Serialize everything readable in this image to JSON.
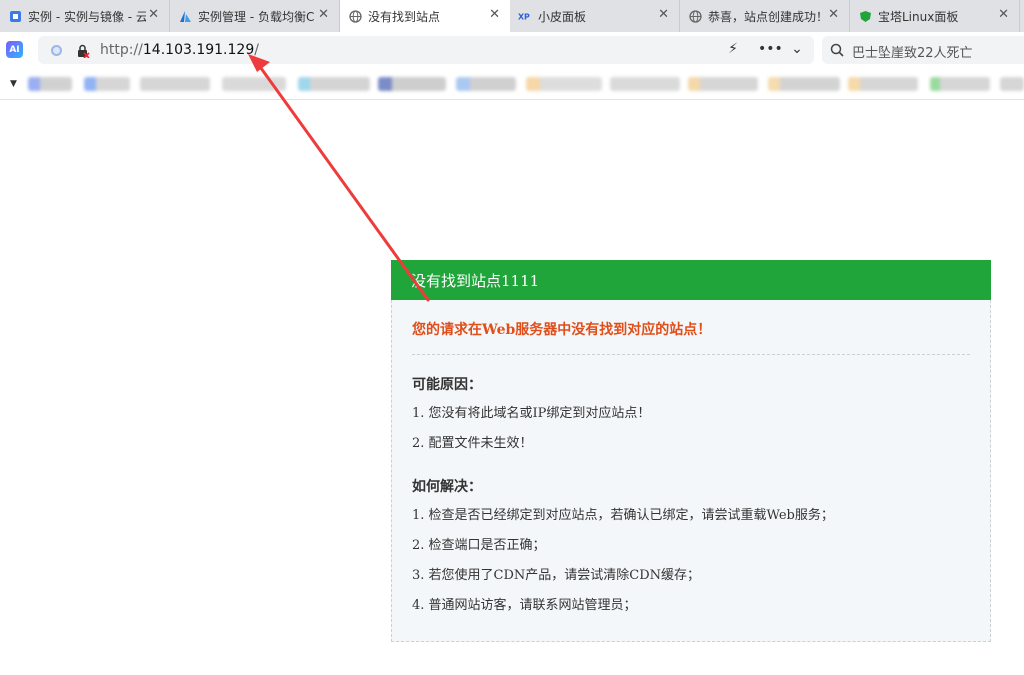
{
  "tabs": [
    {
      "label": "实例 - 实例与镜像 - 云",
      "icon": "cube-icon",
      "active": false
    },
    {
      "label": "实例管理 - 负载均衡C",
      "icon": "azure-icon",
      "active": false
    },
    {
      "label": "没有找到站点",
      "icon": "globe-icon",
      "active": true
    },
    {
      "label": "小皮面板",
      "icon": "xp-logo-icon",
      "active": false
    },
    {
      "label": "恭喜，站点创建成功！",
      "icon": "globe-icon",
      "active": false
    },
    {
      "label": "宝塔Linux面板",
      "icon": "shield-icon",
      "active": false
    }
  ],
  "address": {
    "scheme": "http://",
    "host": "14.103.191.129",
    "path": "/"
  },
  "search": {
    "text": "巴士坠崖致22人死亡"
  },
  "panel": {
    "title": "没有找到站点1111",
    "error": "您的请求在Web服务器中没有找到对应的站点！",
    "reasons_title": "可能原因：",
    "reasons": [
      "1. 您没有将此域名或IP绑定到对应站点！",
      "2. 配置文件未生效！"
    ],
    "solutions_title": "如何解决：",
    "solutions": [
      "1. 检查是否已经绑定到对应站点，若确认已绑定，请尝试重载Web服务；",
      "2. 检查端口是否正确；",
      "3. 若您使用了CDN产品，请尝试清除CDN缓存；",
      "4. 普通网站访客，请联系网站管理员；"
    ]
  },
  "colors": {
    "header_green": "#20a53a",
    "error_red": "#e04e1a",
    "arrow_red": "#ee3b3b"
  }
}
